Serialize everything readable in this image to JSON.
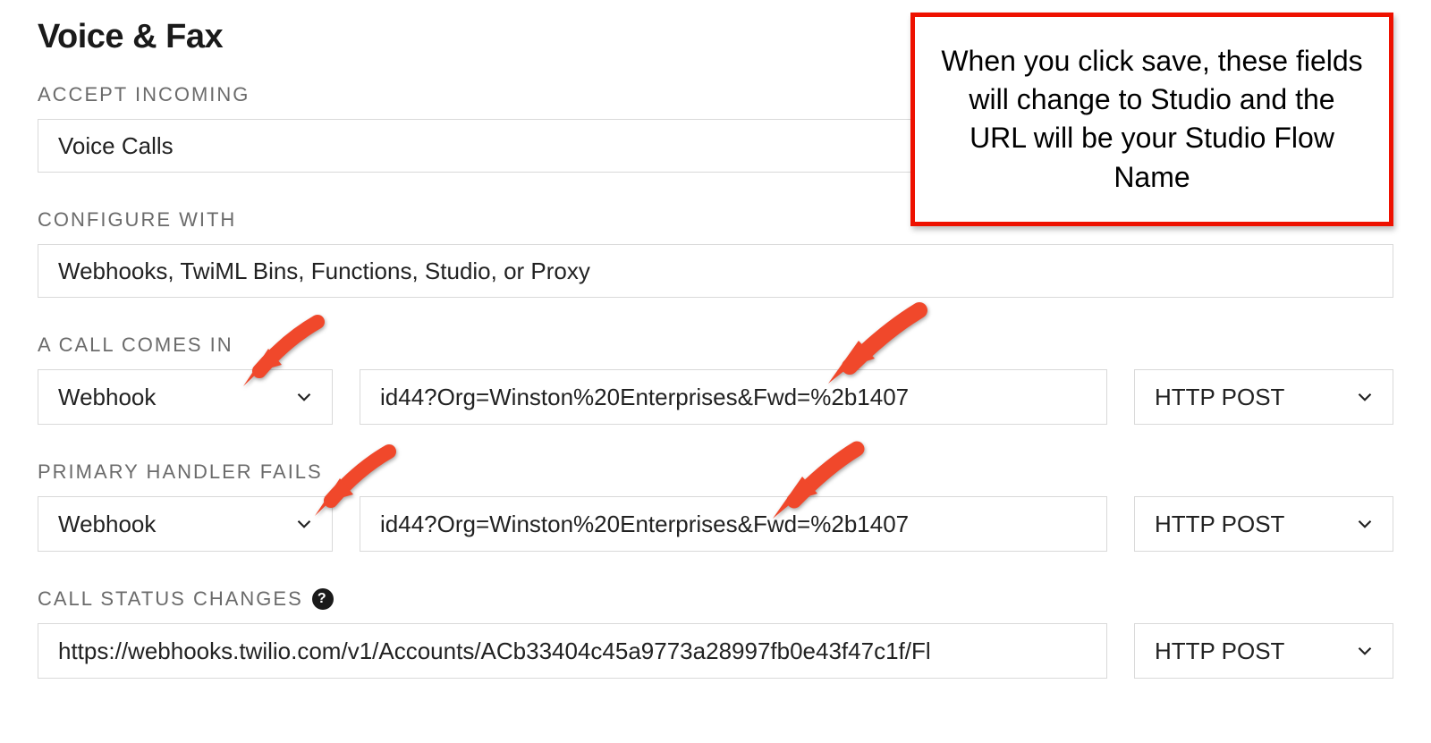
{
  "section": {
    "title": "Voice & Fax"
  },
  "accept_incoming": {
    "label": "ACCEPT INCOMING",
    "value": "Voice Calls"
  },
  "configure_with": {
    "label": "CONFIGURE WITH",
    "value": "Webhooks, TwiML Bins, Functions, Studio, or Proxy"
  },
  "call_comes_in": {
    "label": "A CALL COMES IN",
    "type": "Webhook",
    "url": "id44?Org=Winston%20Enterprises&Fwd=%2b1407",
    "method": "HTTP POST"
  },
  "primary_handler_fails": {
    "label": "PRIMARY HANDLER FAILS",
    "type": "Webhook",
    "url": "id44?Org=Winston%20Enterprises&Fwd=%2b1407",
    "method": "HTTP POST"
  },
  "call_status_changes": {
    "label": "CALL STATUS CHANGES",
    "url": "https://webhooks.twilio.com/v1/Accounts/ACb33404c45a9773a28997fb0e43f47c1f/Fl",
    "method": "HTTP POST"
  },
  "callout": {
    "text": "When you click save, these fields will change to Studio and the URL will be your Studio Flow Name"
  },
  "help_glyph": "?"
}
